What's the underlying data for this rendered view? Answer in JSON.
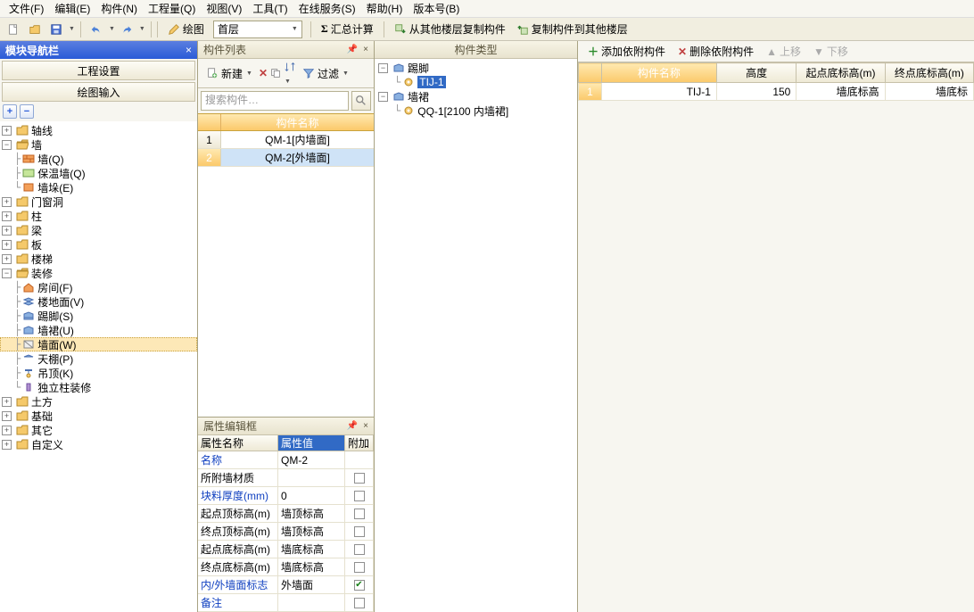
{
  "menu": {
    "items": [
      "文件(F)",
      "编辑(E)",
      "构件(N)",
      "工程量(Q)",
      "视图(V)",
      "工具(T)",
      "在线服务(S)",
      "帮助(H)",
      "版本号(B)"
    ]
  },
  "toolbar": {
    "draw_label": "绘图",
    "layer_label": "首层",
    "sum_label": "汇总计算",
    "copy_from_label": "从其他楼层复制构件",
    "copy_to_label": "复制构件到其他楼层"
  },
  "nav": {
    "title": "模块导航栏",
    "project_settings": "工程设置",
    "draw_input": "绘图输入",
    "tree": {
      "axis": "轴线",
      "wall": "墙",
      "wall_q": "墙(Q)",
      "wall_insul": "保温墙(Q)",
      "wall_block": "墙垛(E)",
      "door": "门窗洞",
      "column": "柱",
      "beam": "梁",
      "slab": "板",
      "stair": "楼梯",
      "decor": "装修",
      "room": "房间(F)",
      "floor": "楼地面(V)",
      "skirting": "踢脚(S)",
      "wainscot": "墙裙(U)",
      "wallface": "墙面(W)",
      "ceiling": "天棚(P)",
      "suspend": "吊顶(K)",
      "col_decor": "独立柱装修",
      "earth": "土方",
      "foundation": "基础",
      "other": "其它",
      "custom": "自定义"
    }
  },
  "componentList": {
    "title": "构件列表",
    "new_label": "新建",
    "filter_label": "过滤",
    "search_placeholder": "搜索构件…",
    "header": "构件名称",
    "rows": [
      {
        "n": "1",
        "name": "QM-1[内墙面]"
      },
      {
        "n": "2",
        "name": "QM-2[外墙面]"
      }
    ]
  },
  "propBox": {
    "title": "属性编辑框",
    "h_name": "属性名称",
    "h_val": "属性值",
    "h_add": "附加",
    "rows": [
      {
        "k": "名称",
        "v": "QM-2",
        "link": true
      },
      {
        "k": "所附墙材质",
        "v": "",
        "cb": false
      },
      {
        "k": "块料厚度(mm)",
        "v": "0",
        "link": true,
        "cb": false
      },
      {
        "k": "起点顶标高(m)",
        "v": "墙顶标高",
        "cb": false
      },
      {
        "k": "终点顶标高(m)",
        "v": "墙顶标高",
        "cb": false
      },
      {
        "k": "起点底标高(m)",
        "v": "墙底标高",
        "cb": false
      },
      {
        "k": "终点底标高(m)",
        "v": "墙底标高",
        "cb": false
      },
      {
        "k": "内/外墙面标志",
        "v": "外墙面",
        "link": true,
        "cb": true,
        "checked": true
      },
      {
        "k": "备注",
        "v": "",
        "link": true,
        "cb": false
      }
    ]
  },
  "typePanel": {
    "title": "构件类型",
    "tree": {
      "skirting": "踢脚",
      "skirting_item": "TIJ-1",
      "wainscot": "墙裙",
      "wainscot_item": "QQ-1[2100 内墙裙]"
    }
  },
  "rightBar": {
    "add": "添加依附构件",
    "del": "删除依附构件",
    "up": "上移",
    "down": "下移"
  },
  "dataTable": {
    "headers": [
      "构件名称",
      "高度",
      "起点底标高(m)",
      "终点底标高(m)"
    ],
    "row": {
      "name": "TIJ-1",
      "height": "150",
      "start": "墙底标高",
      "end": "墙底标"
    }
  }
}
